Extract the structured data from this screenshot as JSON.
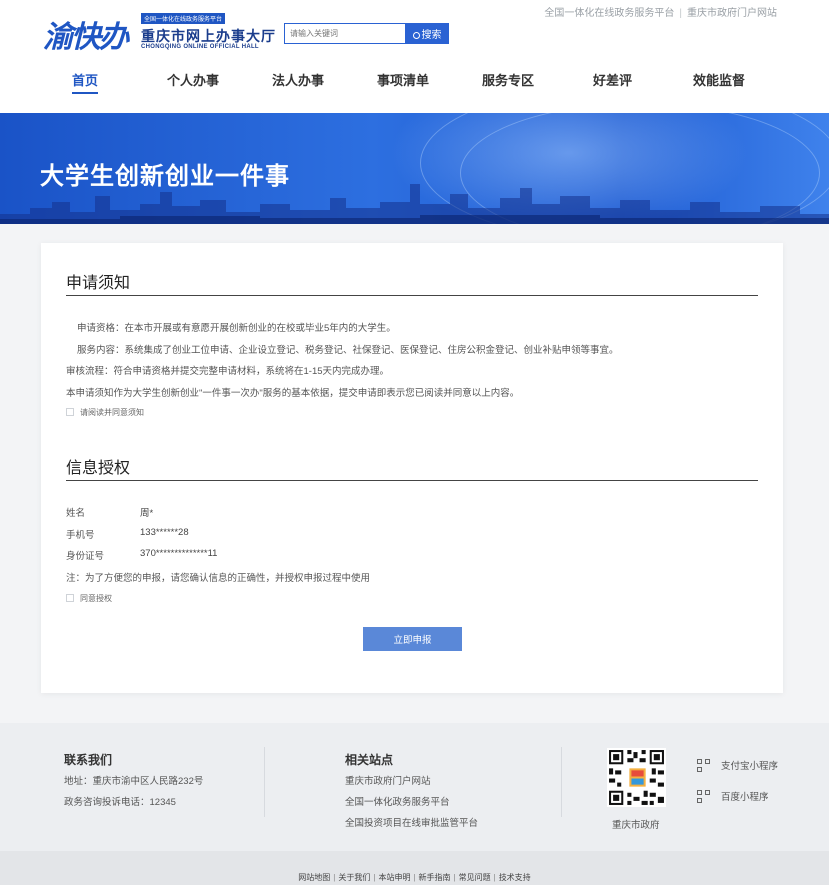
{
  "header": {
    "top_links": [
      "全国一体化在线政务服务平台",
      "重庆市政府门户网站"
    ],
    "logo_mark": "渝快办",
    "logo_badge": "全国一体化在线政务服务平台",
    "logo_name": "重庆市网上办事大厅",
    "logo_en": "CHONGQING ONLINE OFFICIAL HALL",
    "search_placeholder": "请输入关键词",
    "search_button": "搜索",
    "nav": [
      "首页",
      "个人办事",
      "法人办事",
      "事项清单",
      "服务专区",
      "好差评",
      "效能监督"
    ],
    "active_nav": 0
  },
  "banner": {
    "title": "大学生创新创业一件事"
  },
  "notice": {
    "title": "申请须知",
    "lines": [
      "申请资格：在本市开展或有意愿开展创新创业的在校或毕业5年内的大学生。",
      "服务内容：系统集成了创业工位申请、企业设立登记、税务登记、社保登记、医保登记、住房公积金登记、创业补贴申领等事宜。",
      "审核流程：符合申请资格并提交完整申请材料，系统将在1-15天内完成办理。",
      "本申请须知作为大学生创新创业\"一件事一次办\"服务的基本依据，提交申请即表示您已阅读并同意以上内容。"
    ],
    "agree_label": "请阅读并同意须知",
    "agree_checked": false
  },
  "auth": {
    "title": "信息授权",
    "fields": [
      {
        "label": "姓名",
        "value": "周*"
      },
      {
        "label": "手机号",
        "value": "133******28"
      },
      {
        "label": "身份证号",
        "value": "370**************11"
      }
    ],
    "note": "注：为了方便您的申报，请您确认信息的正确性，并授权申报过程中使用",
    "agree_label": "同意授权",
    "agree_checked": false,
    "submit_label": "立即申报"
  },
  "footer": {
    "contact_title": "联系我们",
    "address": "地址：重庆市渝中区人民路232号",
    "hotline": "政务咨询投诉电话：12345",
    "sites_title": "相关站点",
    "sites": [
      "重庆市政府门户网站",
      "全国一体化政务服务平台",
      "全国投资项目在线审批监管平台"
    ],
    "qr_label": "重庆市政府",
    "mini_programs": [
      "支付宝小程序",
      "百度小程序"
    ],
    "bottom_links": [
      "网站地图",
      "关于我们",
      "本站申明",
      "新手指南",
      "常见问题",
      "技术支持"
    ]
  },
  "colors": {
    "brand": "#1f56c3",
    "button": "#5a88d8",
    "banner": "#2d6fe0"
  }
}
